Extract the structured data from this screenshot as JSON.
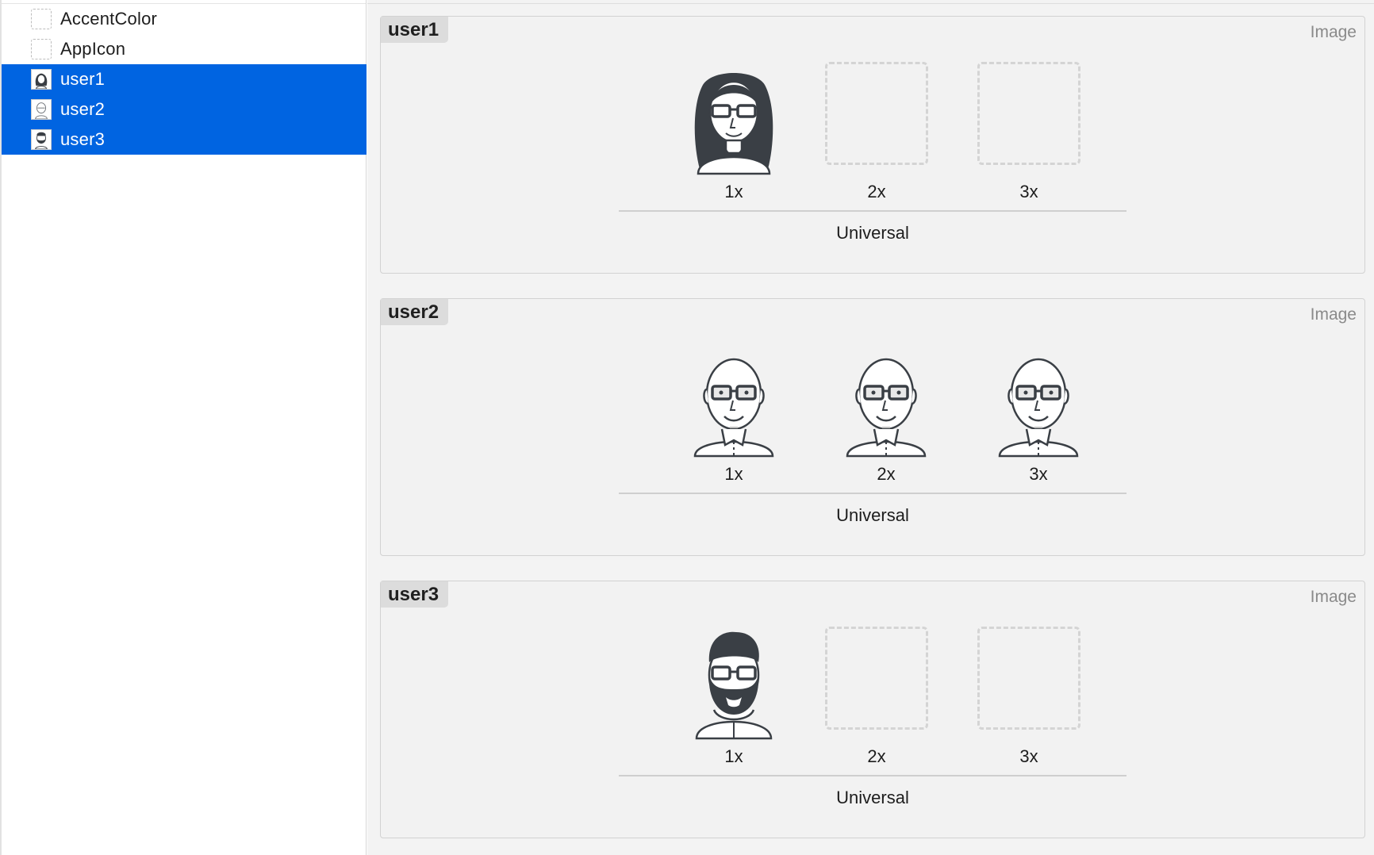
{
  "sidebar": {
    "items": [
      {
        "label": "AccentColor",
        "thumb": "empty-dashed-icon",
        "selected": false
      },
      {
        "label": "AppIcon",
        "thumb": "empty-dashed-icon",
        "selected": false
      },
      {
        "label": "user1",
        "thumb": "woman-avatar-thumbnail",
        "selected": true
      },
      {
        "label": "user2",
        "thumb": "bald-man-avatar-thumbnail",
        "selected": true
      },
      {
        "label": "user3",
        "thumb": "bearded-man-avatar-thumbnail",
        "selected": true
      }
    ],
    "selection_color": "#0064e1"
  },
  "assets": [
    {
      "name": "user1",
      "kind": "Image",
      "slots": [
        {
          "label": "1x",
          "filled": true,
          "icon": "woman-avatar-icon"
        },
        {
          "label": "2x",
          "filled": false
        },
        {
          "label": "3x",
          "filled": false
        }
      ],
      "idiom": "Universal"
    },
    {
      "name": "user2",
      "kind": "Image",
      "slots": [
        {
          "label": "1x",
          "filled": true,
          "icon": "bald-man-avatar-icon"
        },
        {
          "label": "2x",
          "filled": true,
          "icon": "bald-man-avatar-icon"
        },
        {
          "label": "3x",
          "filled": true,
          "icon": "bald-man-avatar-icon"
        }
      ],
      "idiom": "Universal"
    },
    {
      "name": "user3",
      "kind": "Image",
      "slots": [
        {
          "label": "1x",
          "filled": true,
          "icon": "bearded-man-avatar-icon"
        },
        {
          "label": "2x",
          "filled": false
        },
        {
          "label": "3x",
          "filled": false
        }
      ],
      "idiom": "Universal"
    }
  ]
}
